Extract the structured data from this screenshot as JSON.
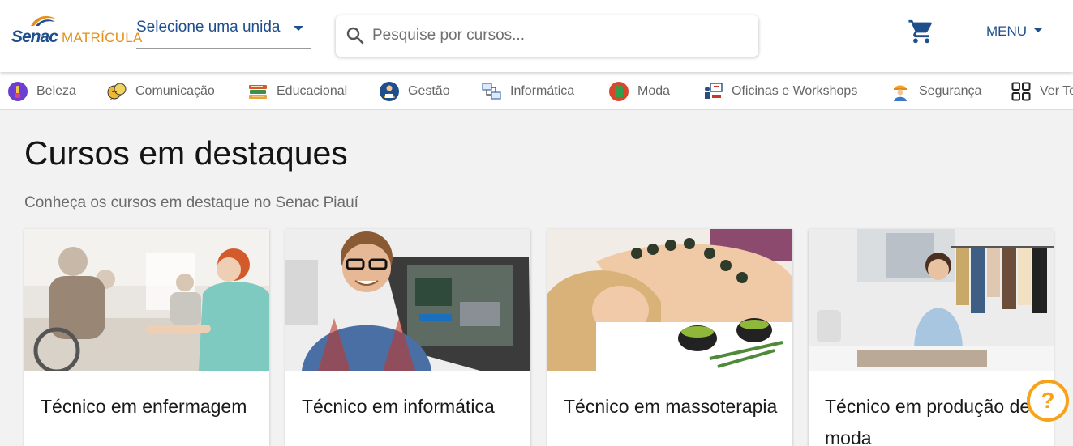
{
  "header": {
    "logo": {
      "brand": "Senac",
      "product": "MATRÍCULA"
    },
    "unit_select": {
      "value": "Selecione uma unida"
    },
    "search": {
      "placeholder": "Pesquise por cursos..."
    },
    "menu_label": "MENU"
  },
  "categories": [
    {
      "label": "Beleza",
      "icon": "beauty-icon"
    },
    {
      "label": "Comunicação",
      "icon": "communication-icon"
    },
    {
      "label": "Educacional",
      "icon": "books-icon"
    },
    {
      "label": "Gestão",
      "icon": "management-icon"
    },
    {
      "label": "Informática",
      "icon": "computer-network-icon"
    },
    {
      "label": "Moda",
      "icon": "fashion-icon"
    },
    {
      "label": "Oficinas e Workshops",
      "icon": "workshop-icon"
    },
    {
      "label": "Segurança",
      "icon": "safety-worker-icon"
    },
    {
      "label": "Ver Todos",
      "icon": "grid-icon"
    }
  ],
  "main": {
    "title": "Cursos em destaques",
    "subtitle": "Conheça os cursos em destaque no Senac Piauí",
    "courses": [
      {
        "title": "Técnico em enfermagem",
        "image": "nurse-with-elderly-patient-photo"
      },
      {
        "title": "Técnico em informática",
        "image": "technician-repairing-computer-photo"
      },
      {
        "title": "Técnico em massoterapia",
        "image": "massage-therapy-photo"
      },
      {
        "title": "Técnico em produção de moda",
        "image": "fashion-studio-photo"
      }
    ]
  },
  "help_button": {
    "label": "?"
  },
  "colors": {
    "brand_blue": "#1f4e8c",
    "brand_orange": "#e3901c",
    "help_orange": "#f7a21b",
    "page_bg": "#f2f2f2"
  }
}
